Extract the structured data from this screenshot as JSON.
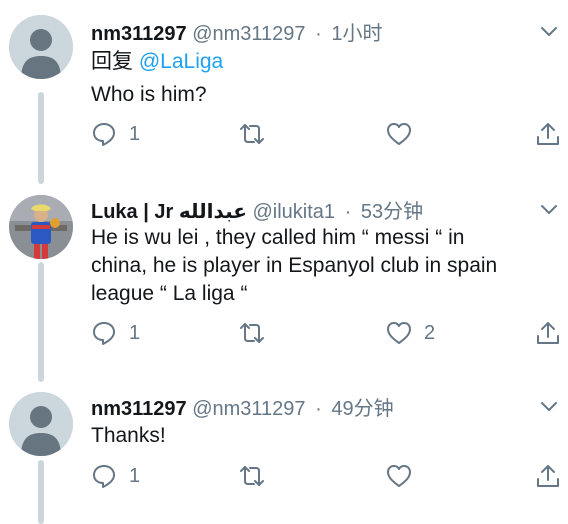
{
  "tweets": [
    {
      "display_name": "nm311297",
      "handle": "@nm311297",
      "time": "1小时",
      "reply_prefix": "回复",
      "mention": "@LaLiga",
      "text": "Who is him?",
      "replies": "1",
      "retweets": "",
      "likes": ""
    },
    {
      "display_name": "Luka | Jr عبدالله",
      "handle": "@ilukita1",
      "time": "53分钟",
      "text_lines": [
        "He is wu lei , they called him “ messi “ in",
        "china, he is player in Espanyol club in spain",
        "league “ La liga “"
      ],
      "replies": "1",
      "retweets": "",
      "likes": "2"
    },
    {
      "display_name": "nm311297",
      "handle": "@nm311297",
      "time": "49分钟",
      "text": "Thanks!",
      "replies": "1",
      "retweets": "",
      "likes": ""
    }
  ],
  "icons": {
    "reply": "reply-icon",
    "retweet": "retweet-icon",
    "like": "heart-icon",
    "share": "share-icon",
    "menu": "chevron-down-icon"
  },
  "colors": {
    "text": "#14171a",
    "secondary": "#657786",
    "link": "#1da1f2",
    "thread_line": "#ccd6dd",
    "avatar_placeholder": "#ccd6dd"
  }
}
